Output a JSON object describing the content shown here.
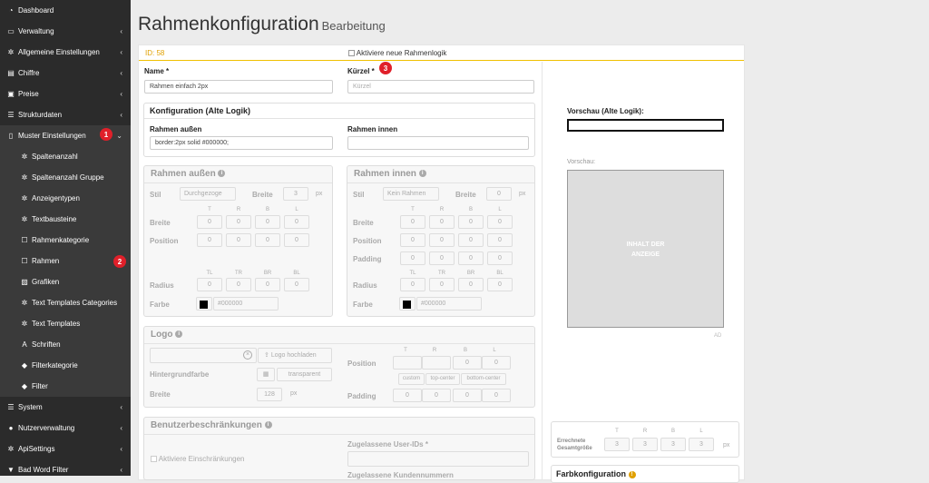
{
  "sidebar": {
    "items": [
      {
        "icon": "dashboard-icon",
        "glyph": "◔",
        "label": "Dashboard",
        "chevron": ""
      },
      {
        "icon": "monitor-icon",
        "glyph": "▭",
        "label": "Verwaltung",
        "chevron": "‹"
      },
      {
        "icon": "cogs-icon",
        "glyph": "✲",
        "label": "Allgemeine Einstellungen",
        "chevron": "‹"
      },
      {
        "icon": "archive-icon",
        "glyph": "▤",
        "label": "Chiffre",
        "chevron": "‹"
      },
      {
        "icon": "money-icon",
        "glyph": "▣",
        "label": "Preise",
        "chevron": "‹"
      },
      {
        "icon": "list-icon",
        "glyph": "☰",
        "label": "Strukturdaten",
        "chevron": "‹"
      },
      {
        "icon": "file-icon",
        "glyph": "▯",
        "label": "Muster Einstellungen",
        "chevron": "⌄"
      },
      {
        "icon": "gear-icon",
        "glyph": "✲",
        "label": "Spaltenanzahl",
        "chevron": "",
        "sub": true
      },
      {
        "icon": "gear-icon",
        "glyph": "✲",
        "label": "Spaltenanzahl Gruppe",
        "chevron": "",
        "sub": true
      },
      {
        "icon": "gear-icon",
        "glyph": "✲",
        "label": "Anzeigentypen",
        "chevron": "",
        "sub": true
      },
      {
        "icon": "gear-icon",
        "glyph": "✲",
        "label": "Textbausteine",
        "chevron": "",
        "sub": true
      },
      {
        "icon": "square-icon",
        "glyph": "☐",
        "label": "Rahmenkategorie",
        "chevron": "",
        "sub": true
      },
      {
        "icon": "square-icon",
        "glyph": "☐",
        "label": "Rahmen",
        "chevron": "",
        "sub": true
      },
      {
        "icon": "image-icon",
        "glyph": "▨",
        "label": "Grafiken",
        "chevron": "",
        "sub": true
      },
      {
        "icon": "gear-icon",
        "glyph": "✲",
        "label": "Text Templates Categories",
        "chevron": "",
        "sub": true
      },
      {
        "icon": "gear-icon",
        "glyph": "✲",
        "label": "Text Templates",
        "chevron": "",
        "sub": true
      },
      {
        "icon": "font-icon",
        "glyph": "A",
        "label": "Schriften",
        "chevron": "",
        "sub": true
      },
      {
        "icon": "tag-icon",
        "glyph": "◆",
        "label": "Filterkategorie",
        "chevron": "",
        "sub": true
      },
      {
        "icon": "tag-icon",
        "glyph": "◆",
        "label": "Filter",
        "chevron": "",
        "sub": true
      },
      {
        "icon": "list-icon",
        "glyph": "☰",
        "label": "System",
        "chevron": "‹"
      },
      {
        "icon": "user-icon",
        "glyph": "●",
        "label": "Nutzerverwaltung",
        "chevron": "‹"
      },
      {
        "icon": "cogs-icon",
        "glyph": "✲",
        "label": "ApiSettings",
        "chevron": "‹"
      },
      {
        "icon": "filter-icon",
        "glyph": "▼",
        "label": "Bad Word Filter",
        "chevron": "‹"
      }
    ],
    "badges": [
      "1",
      "2"
    ]
  },
  "header": {
    "title": "Rahmenkonfiguration",
    "subtitle": "Bearbeitung"
  },
  "form": {
    "id_label": "ID: 58",
    "new_logic_label": "Aktiviere neue Rahmenlogik",
    "name_label": "Name *",
    "name_value": "Rahmen einfach 2px",
    "kuerzel_label": "Kürzel *",
    "kuerzel_badge": "3",
    "kuerzel_placeholder": "Kürzel",
    "old_config_title": "Konfiguration (Alte Logik)",
    "rahmen_aussen_label": "Rahmen außen",
    "rahmen_aussen_value": "border:2px solid #000000;",
    "rahmen_innen_label": "Rahmen innen"
  },
  "outer": {
    "title": "Rahmen außen",
    "stil_label": "Stil",
    "stil_value": "Durchgezoge",
    "breite_label": "Breite",
    "breite_value": "3",
    "px": "px",
    "cols": [
      "T",
      "R",
      "B",
      "L"
    ],
    "rows": [
      {
        "label": "Breite",
        "values": [
          "0",
          "0",
          "0",
          "0"
        ]
      },
      {
        "label": "Position",
        "values": [
          "0",
          "0",
          "0",
          "0"
        ]
      }
    ],
    "radius_cols": [
      "TL",
      "TR",
      "BR",
      "BL"
    ],
    "radius_label": "Radius",
    "radius_values": [
      "0",
      "0",
      "0",
      "0"
    ],
    "farbe_label": "Farbe",
    "farbe_value": "#000000"
  },
  "inner": {
    "title": "Rahmen innen",
    "stil_label": "Stil",
    "stil_value": "Kein Rahmen",
    "breite_label": "Breite",
    "breite_value": "0",
    "px": "px",
    "cols": [
      "T",
      "R",
      "B",
      "L"
    ],
    "rows": [
      {
        "label": "Breite",
        "values": [
          "0",
          "0",
          "0",
          "0"
        ]
      },
      {
        "label": "Position",
        "values": [
          "0",
          "0",
          "0",
          "0"
        ]
      },
      {
        "label": "Padding",
        "values": [
          "0",
          "0",
          "0",
          "0"
        ]
      }
    ],
    "radius_cols": [
      "TL",
      "TR",
      "BR",
      "BL"
    ],
    "radius_label": "Radius",
    "radius_values": [
      "0",
      "0",
      "0",
      "0"
    ],
    "farbe_label": "Farbe",
    "farbe_value": "#000000"
  },
  "logo": {
    "title": "Logo",
    "upload_label": "Logo hochladen",
    "hintergrund_label": "Hintergrundfarbe",
    "hintergrund_value": "transparent",
    "breite_label": "Breite",
    "breite_value": "128",
    "px": "px",
    "cols": [
      "T",
      "R",
      "B",
      "L"
    ],
    "position_label": "Position",
    "position_values": [
      "",
      "",
      "0",
      "0"
    ],
    "position_buttons": [
      "custom",
      "top-center",
      "bottom-center"
    ],
    "padding_label": "Padding",
    "padding_values": [
      "0",
      "0",
      "0",
      "0"
    ]
  },
  "restrictions": {
    "title": "Benutzerbeschränkungen",
    "activate_label": "Aktiviere Einschränkungen",
    "user_ids_label": "Zugelassene User-IDs *",
    "customer_label": "Zugelassene Kundennummern"
  },
  "preview": {
    "old_label": "Vorschau (Alte Logik):",
    "label": "Vorschau:",
    "content_line1": "INHALT DER",
    "content_line2": "ANZEIGE",
    "ad": "AD",
    "calc_label_1": "Errechnete",
    "calc_label_2": "Gesamtgröße",
    "cols": [
      "T",
      "R",
      "B",
      "L"
    ],
    "calc_values": [
      "3",
      "3",
      "3",
      "3"
    ],
    "px": "px",
    "color_config": "Farbkonfiguration"
  }
}
